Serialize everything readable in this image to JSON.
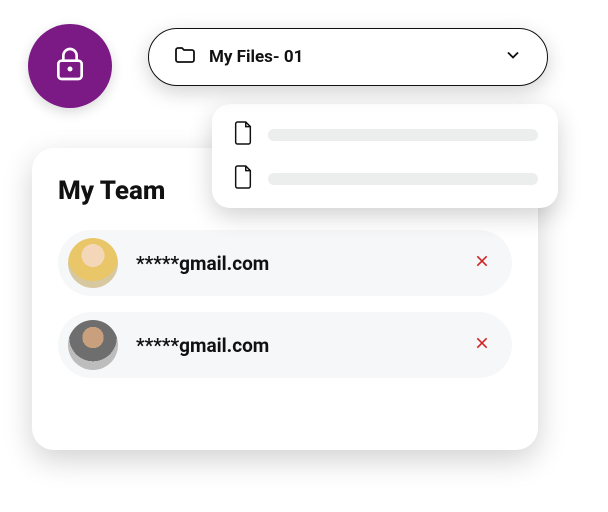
{
  "accent_color": "#7b1985",
  "folder_select": {
    "label": "My Files- 01"
  },
  "dropdown": {
    "items": [
      {
        "placeholder": true
      },
      {
        "placeholder": true
      }
    ]
  },
  "team": {
    "title": "My Team",
    "members": [
      {
        "email": "*****gmail.com"
      },
      {
        "email": "*****gmail.com"
      }
    ]
  }
}
